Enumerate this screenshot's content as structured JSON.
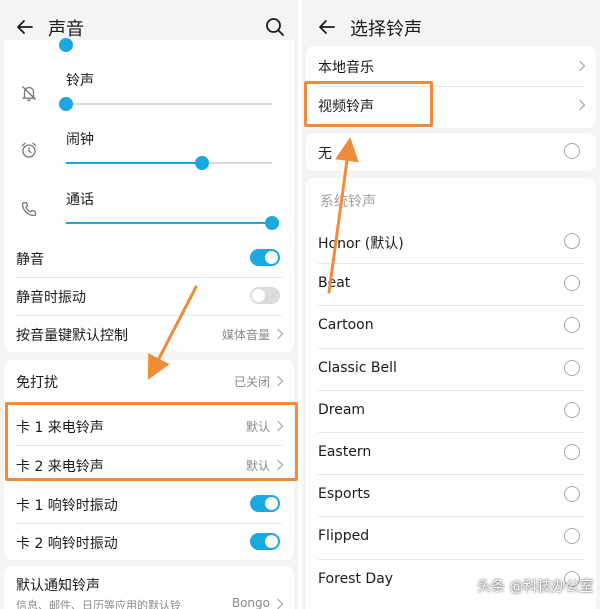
{
  "left_screen": {
    "title": "声音",
    "volume": [
      {
        "label": "铃声",
        "level": 0.0,
        "icon": "bell-off-icon"
      },
      {
        "label": "闹钟",
        "level": 0.66,
        "icon": "alarm-clock-icon"
      },
      {
        "label": "通话",
        "level": 1.0,
        "icon": "phone-icon"
      }
    ],
    "settings_top": [
      {
        "label": "静音",
        "toggle": true
      },
      {
        "label": "静音时振动",
        "toggle": false
      },
      {
        "label": "按音量键默认控制",
        "value": "媒体音量"
      }
    ],
    "dnd": {
      "label": "免打扰",
      "value": "已关闭"
    },
    "ringtones": [
      {
        "label": "卡 1 来电铃声",
        "value": "默认"
      },
      {
        "label": "卡 2 来电铃声",
        "value": "默认"
      }
    ],
    "vibrate": [
      {
        "label": "卡 1 响铃时振动",
        "toggle": true
      },
      {
        "label": "卡 2 响铃时振动",
        "toggle": true
      }
    ],
    "notification": {
      "label": "默认通知铃声",
      "sub": "信息、邮件、日历等应用的默认铃",
      "value": "Bongo"
    }
  },
  "right_screen": {
    "title": "选择铃声",
    "sources": [
      {
        "label": "本地音乐"
      },
      {
        "label": "视频铃声"
      }
    ],
    "none_option": "无",
    "system_section_title": "系统铃声",
    "system_ringtones": [
      "Honor (默认)",
      "Beat",
      "Cartoon",
      "Classic Bell",
      "Dream",
      "Eastern",
      "Esports",
      "Flipped",
      "Forest Day"
    ]
  },
  "watermark": "头条 @科技办公室",
  "colors": {
    "accent": "#1aa8e0",
    "highlight": "#ef8c3a",
    "background": "#f4f4f4"
  }
}
